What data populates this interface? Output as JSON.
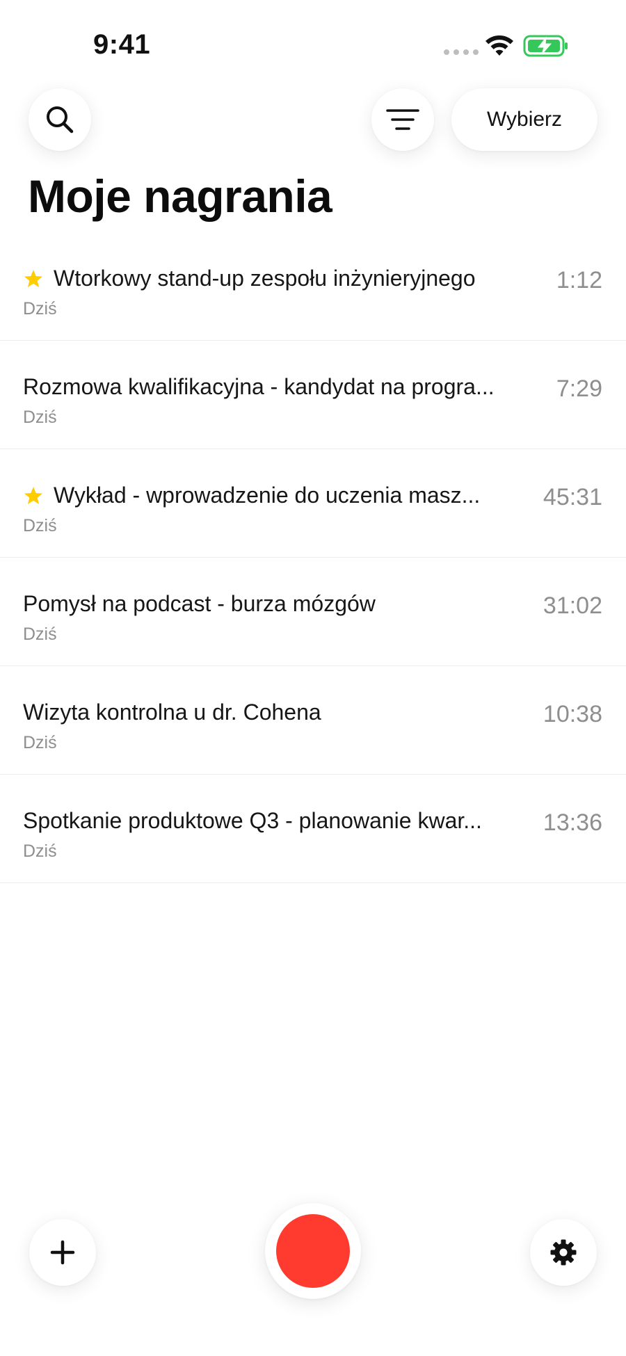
{
  "status_bar": {
    "time": "9:41"
  },
  "header": {
    "select_label": "Wybierz",
    "title": "Moje nagrania"
  },
  "recordings": [
    {
      "title": "Wtorkowy stand-up zespołu inżynieryjnego",
      "date": "Dziś",
      "duration": "1:12",
      "starred": true
    },
    {
      "title": "Rozmowa kwalifikacyjna - kandydat na progra...",
      "date": "Dziś",
      "duration": "7:29",
      "starred": false
    },
    {
      "title": "Wykład - wprowadzenie do uczenia masz...",
      "date": "Dziś",
      "duration": "45:31",
      "starred": true
    },
    {
      "title": "Pomysł na podcast - burza mózgów",
      "date": "Dziś",
      "duration": "31:02",
      "starred": false
    },
    {
      "title": "Wizyta kontrolna u dr. Cohena",
      "date": "Dziś",
      "duration": "10:38",
      "starred": false
    },
    {
      "title": "Spotkanie produktowe Q3 - planowanie kwar...",
      "date": "Dziś",
      "duration": "13:36",
      "starred": false
    }
  ],
  "icons": {
    "search": "search-icon",
    "filter": "filter-icon",
    "star": "star-icon",
    "add": "plus-icon",
    "record": "record-icon",
    "settings": "gear-icon",
    "wifi": "wifi-icon",
    "battery": "battery-charging-icon"
  },
  "colors": {
    "record": "#ff3b30",
    "star": "#ffcc00",
    "battery": "#34c759",
    "secondary_text": "#8e8e8e"
  }
}
